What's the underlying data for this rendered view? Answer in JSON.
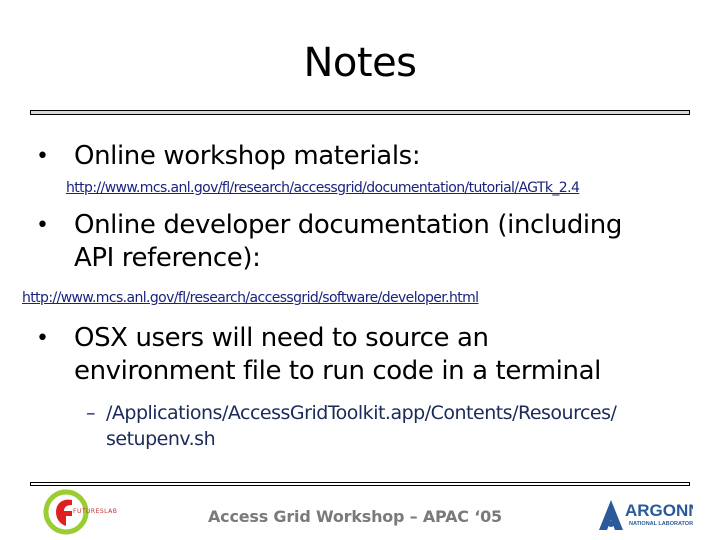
{
  "slide": {
    "title": "Notes",
    "bullets": [
      {
        "text": "Online workshop materials:",
        "link": "http://www.mcs.anl.gov/fl/research/accessgrid/documentation/tutorial/AGTk_2.4"
      },
      {
        "text_line1": "Online developer documentation (including",
        "text_line2": "API reference):",
        "link": "http://www.mcs.anl.gov/fl/research/accessgrid/software/developer.html"
      },
      {
        "text_line1": "OSX users will need to source an",
        "text_line2": "environment file to run code in a terminal",
        "sub_bullet": {
          "line1": "/Applications/AccessGridToolkit.app/Contents/Resources/",
          "line2": "setupenv.sh"
        }
      }
    ]
  },
  "glyphs": {
    "bullet": "•",
    "dash": "–"
  },
  "footer": {
    "text": "Access Grid Workshop – APAC ‘05",
    "left_logo_text": "FUTURESLAB",
    "right_logo_name": "ARGONNE",
    "right_logo_sub": "NATIONAL LABORATORY"
  },
  "colors": {
    "link": "#1a237e",
    "sub_text": "#1a2a5a",
    "footer_text": "#7a7a7a",
    "logo_green": "#9acd32",
    "logo_red": "#e02020",
    "argonne_blue": "#2a5a9a"
  }
}
